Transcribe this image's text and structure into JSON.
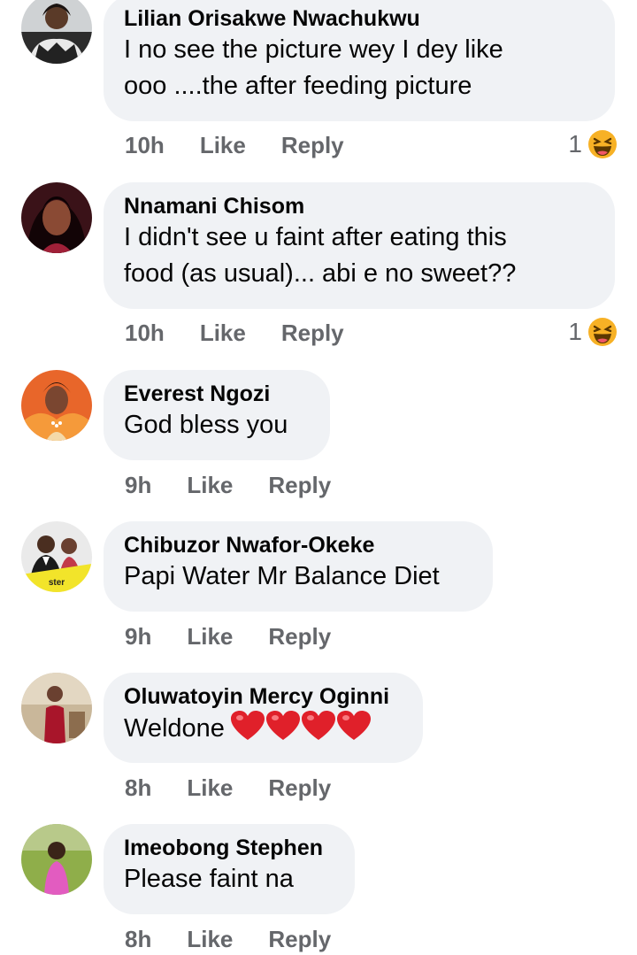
{
  "comments": [
    {
      "author": "Lilian Orisakwe Nwachukwu",
      "text_lines": [
        "I no see the picture wey I dey like",
        "ooo ....the after feeding picture"
      ],
      "time": "10h",
      "like_label": "Like",
      "reply_label": "Reply",
      "reaction_count": "1",
      "reaction_icon": "laugh-emoji-icon"
    },
    {
      "author": "Nnamani Chisom",
      "text_lines": [
        "I didn't see u faint after eating this",
        "food (as usual)... abi e no sweet??"
      ],
      "time": "10h",
      "like_label": "Like",
      "reply_label": "Reply",
      "reaction_count": "1",
      "reaction_icon": "laugh-emoji-icon"
    },
    {
      "author": "Everest Ngozi",
      "text_lines": [
        "God bless you"
      ],
      "time": "9h",
      "like_label": "Like",
      "reply_label": "Reply"
    },
    {
      "author": "Chibuzor Nwafor-Okeke",
      "text_lines": [
        "Papi Water Mr Balance Diet"
      ],
      "time": "9h",
      "like_label": "Like",
      "reply_label": "Reply"
    },
    {
      "author": "Oluwatoyin Mercy Oginni",
      "text_lines": [
        "Weldone"
      ],
      "emoji_hearts": 4,
      "time": "8h",
      "like_label": "Like",
      "reply_label": "Reply"
    },
    {
      "author": "Imeobong Stephen",
      "text_lines": [
        "Please faint na"
      ],
      "time": "8h",
      "like_label": "Like",
      "reply_label": "Reply"
    }
  ],
  "colors": {
    "bubble_bg": "#f0f2f5",
    "meta_text": "#65676b",
    "heart_red": "#e0202a",
    "laugh_yellow": "#f7b125"
  }
}
